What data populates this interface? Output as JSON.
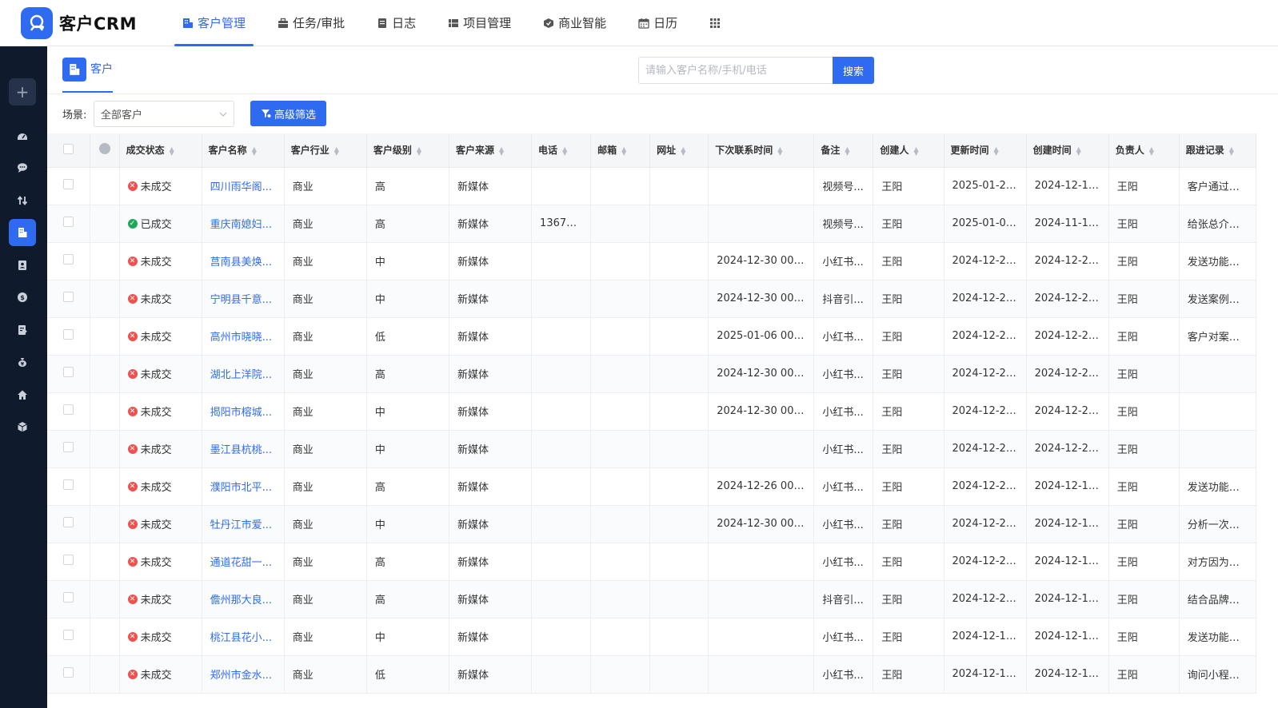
{
  "app": {
    "logo_text": "客户CRM"
  },
  "topnav": [
    {
      "label": "客户管理",
      "icon": "building-icon",
      "active": true
    },
    {
      "label": "任务/审批",
      "icon": "briefcase-icon"
    },
    {
      "label": "日志",
      "icon": "log-icon"
    },
    {
      "label": "项目管理",
      "icon": "project-icon"
    },
    {
      "label": "商业智能",
      "icon": "bi-icon"
    },
    {
      "label": "日历",
      "icon": "calendar-icon"
    }
  ],
  "page_tab": {
    "label": "客户"
  },
  "search": {
    "placeholder": "请输入客户名称/手机/电话",
    "button": "搜索"
  },
  "filter": {
    "scene_label": "场景:",
    "scene_value": "全部客户",
    "advanced_button": "高级筛选"
  },
  "colors": {
    "accent": "#2f6bf0",
    "sidebar": "#0f1b2d",
    "status_won": "#1ea85a",
    "status_lost": "#f0504e"
  },
  "table": {
    "headers": [
      "成交状态",
      "客户名称",
      "客户行业",
      "客户级别",
      "客户来源",
      "电话",
      "邮箱",
      "网址",
      "下次联系时间",
      "备注",
      "创建人",
      "更新时间",
      "创建时间",
      "负责人",
      "跟进记录"
    ],
    "rows": [
      {
        "status": "未成交",
        "won": false,
        "name": "四川雨华阁...",
        "industry": "商业",
        "level": "高",
        "source": "新媒体",
        "phone": "",
        "email": "",
        "url": "",
        "next_contact": "",
        "remark": "视频号...",
        "creator": "王阳",
        "updated": "2025-01-23 ...",
        "created": "2024-12-19 ...",
        "owner": "王阳",
        "followup": "客户通过视..."
      },
      {
        "status": "已成交",
        "won": true,
        "name": "重庆南媳妇...",
        "industry": "商业",
        "level": "高",
        "source": "新媒体",
        "phone": "13678...",
        "email": "",
        "url": "",
        "next_contact": "",
        "remark": "视频号...",
        "creator": "王阳",
        "updated": "2025-01-02 ...",
        "created": "2024-11-19 ...",
        "owner": "王阳",
        "followup": "给张总介绍..."
      },
      {
        "status": "未成交",
        "won": false,
        "name": "莒南县美焕...",
        "industry": "商业",
        "level": "中",
        "source": "新媒体",
        "phone": "",
        "email": "",
        "url": "",
        "next_contact": "2024-12-30 00:0...",
        "remark": "小红书...",
        "creator": "王阳",
        "updated": "2024-12-27 ...",
        "created": "2024-12-24 ...",
        "owner": "王阳",
        "followup": "发送功能表..."
      },
      {
        "status": "未成交",
        "won": false,
        "name": "宁明县千意...",
        "industry": "商业",
        "level": "中",
        "source": "新媒体",
        "phone": "",
        "email": "",
        "url": "",
        "next_contact": "2024-12-30 00:0...",
        "remark": "抖音引...",
        "creator": "王阳",
        "updated": "2024-12-26 ...",
        "created": "2024-12-24 ...",
        "owner": "王阳",
        "followup": "发送案例和..."
      },
      {
        "status": "未成交",
        "won": false,
        "name": "高州市晓晓...",
        "industry": "商业",
        "level": "低",
        "source": "新媒体",
        "phone": "",
        "email": "",
        "url": "",
        "next_contact": "2025-01-06 00:0...",
        "remark": "小红书...",
        "creator": "王阳",
        "updated": "2024-12-26 ...",
        "created": "2024-12-24 ...",
        "owner": "王阳",
        "followup": "客户对案例..."
      },
      {
        "status": "未成交",
        "won": false,
        "name": "湖北上洋院...",
        "industry": "商业",
        "level": "高",
        "source": "新媒体",
        "phone": "",
        "email": "",
        "url": "",
        "next_contact": "2024-12-30 00:0...",
        "remark": "小红书...",
        "creator": "王阳",
        "updated": "2024-12-25 ...",
        "created": "2024-12-25 ...",
        "owner": "王阳",
        "followup": ""
      },
      {
        "status": "未成交",
        "won": false,
        "name": "揭阳市榕城...",
        "industry": "商业",
        "level": "中",
        "source": "新媒体",
        "phone": "",
        "email": "",
        "url": "",
        "next_contact": "2024-12-30 00:0...",
        "remark": "小红书...",
        "creator": "王阳",
        "updated": "2024-12-24 ...",
        "created": "2024-12-24 ...",
        "owner": "王阳",
        "followup": ""
      },
      {
        "status": "未成交",
        "won": false,
        "name": "墨江县杭桃...",
        "industry": "商业",
        "level": "中",
        "source": "新媒体",
        "phone": "",
        "email": "",
        "url": "",
        "next_contact": "",
        "remark": "小红书...",
        "creator": "王阳",
        "updated": "2024-12-24 ...",
        "created": "2024-12-24 ...",
        "owner": "王阳",
        "followup": ""
      },
      {
        "status": "未成交",
        "won": false,
        "name": "濮阳市北平...",
        "industry": "商业",
        "level": "高",
        "source": "新媒体",
        "phone": "",
        "email": "",
        "url": "",
        "next_contact": "2024-12-26 00:0...",
        "remark": "小红书...",
        "creator": "王阳",
        "updated": "2024-12-23 ...",
        "created": "2024-12-13 ...",
        "owner": "王阳",
        "followup": "发送功能表..."
      },
      {
        "status": "未成交",
        "won": false,
        "name": "牡丹江市爱...",
        "industry": "商业",
        "level": "中",
        "source": "新媒体",
        "phone": "",
        "email": "",
        "url": "",
        "next_contact": "2024-12-30 00:0...",
        "remark": "小红书...",
        "creator": "王阳",
        "updated": "2024-12-23 ...",
        "created": "2024-12-13 ...",
        "owner": "王阳",
        "followup": "分析一次性..."
      },
      {
        "status": "未成交",
        "won": false,
        "name": "通道花甜一...",
        "industry": "商业",
        "level": "高",
        "source": "新媒体",
        "phone": "",
        "email": "",
        "url": "",
        "next_contact": "",
        "remark": "小红书...",
        "creator": "王阳",
        "updated": "2024-12-21 ...",
        "created": "2024-12-10 ...",
        "owner": "王阳",
        "followup": "对方因为报..."
      },
      {
        "status": "未成交",
        "won": false,
        "name": "儋州那大良...",
        "industry": "商业",
        "level": "高",
        "source": "新媒体",
        "phone": "",
        "email": "",
        "url": "",
        "next_contact": "",
        "remark": "抖音引...",
        "creator": "王阳",
        "updated": "2024-12-21 ...",
        "created": "2024-12-12 ...",
        "owner": "王阳",
        "followup": "结合品牌信..."
      },
      {
        "status": "未成交",
        "won": false,
        "name": "桃江县花小...",
        "industry": "商业",
        "level": "中",
        "source": "新媒体",
        "phone": "",
        "email": "",
        "url": "",
        "next_contact": "",
        "remark": "小红书...",
        "creator": "王阳",
        "updated": "2024-12-18 ...",
        "created": "2024-12-12 ...",
        "owner": "王阳",
        "followup": "发送功能表..."
      },
      {
        "status": "未成交",
        "won": false,
        "name": "郑州市金水...",
        "industry": "商业",
        "level": "低",
        "source": "新媒体",
        "phone": "",
        "email": "",
        "url": "",
        "next_contact": "",
        "remark": "小红书...",
        "creator": "王阳",
        "updated": "2024-12-18 ...",
        "created": "2024-12-12 ...",
        "owner": "王阳",
        "followup": "询问小程序..."
      }
    ]
  }
}
